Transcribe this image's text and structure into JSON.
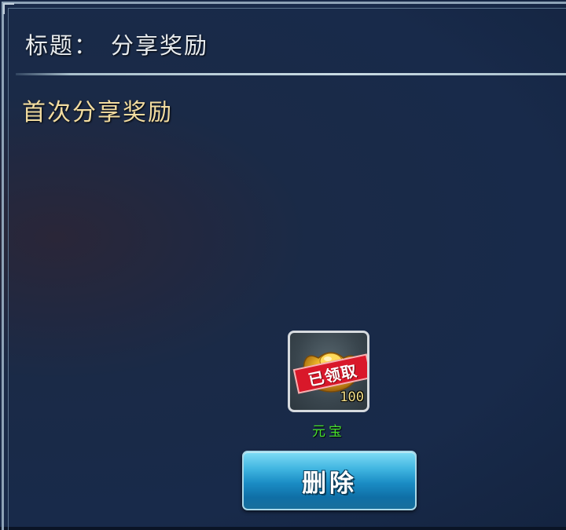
{
  "header": {
    "title_label": "标题：",
    "title_value": "分享奖励"
  },
  "message": {
    "body": "首次分享奖励"
  },
  "attachment": {
    "icon": "gold-ingot-icon",
    "stamp": "已领取",
    "quantity": "100",
    "name": "元宝",
    "claimed": true
  },
  "actions": {
    "delete_label": "删除"
  },
  "colors": {
    "title_text": "#e8ecef",
    "body_text": "#f2dca0",
    "item_name": "#47e02c",
    "stamp": "#d9182a",
    "button": "#1a8cc4"
  }
}
